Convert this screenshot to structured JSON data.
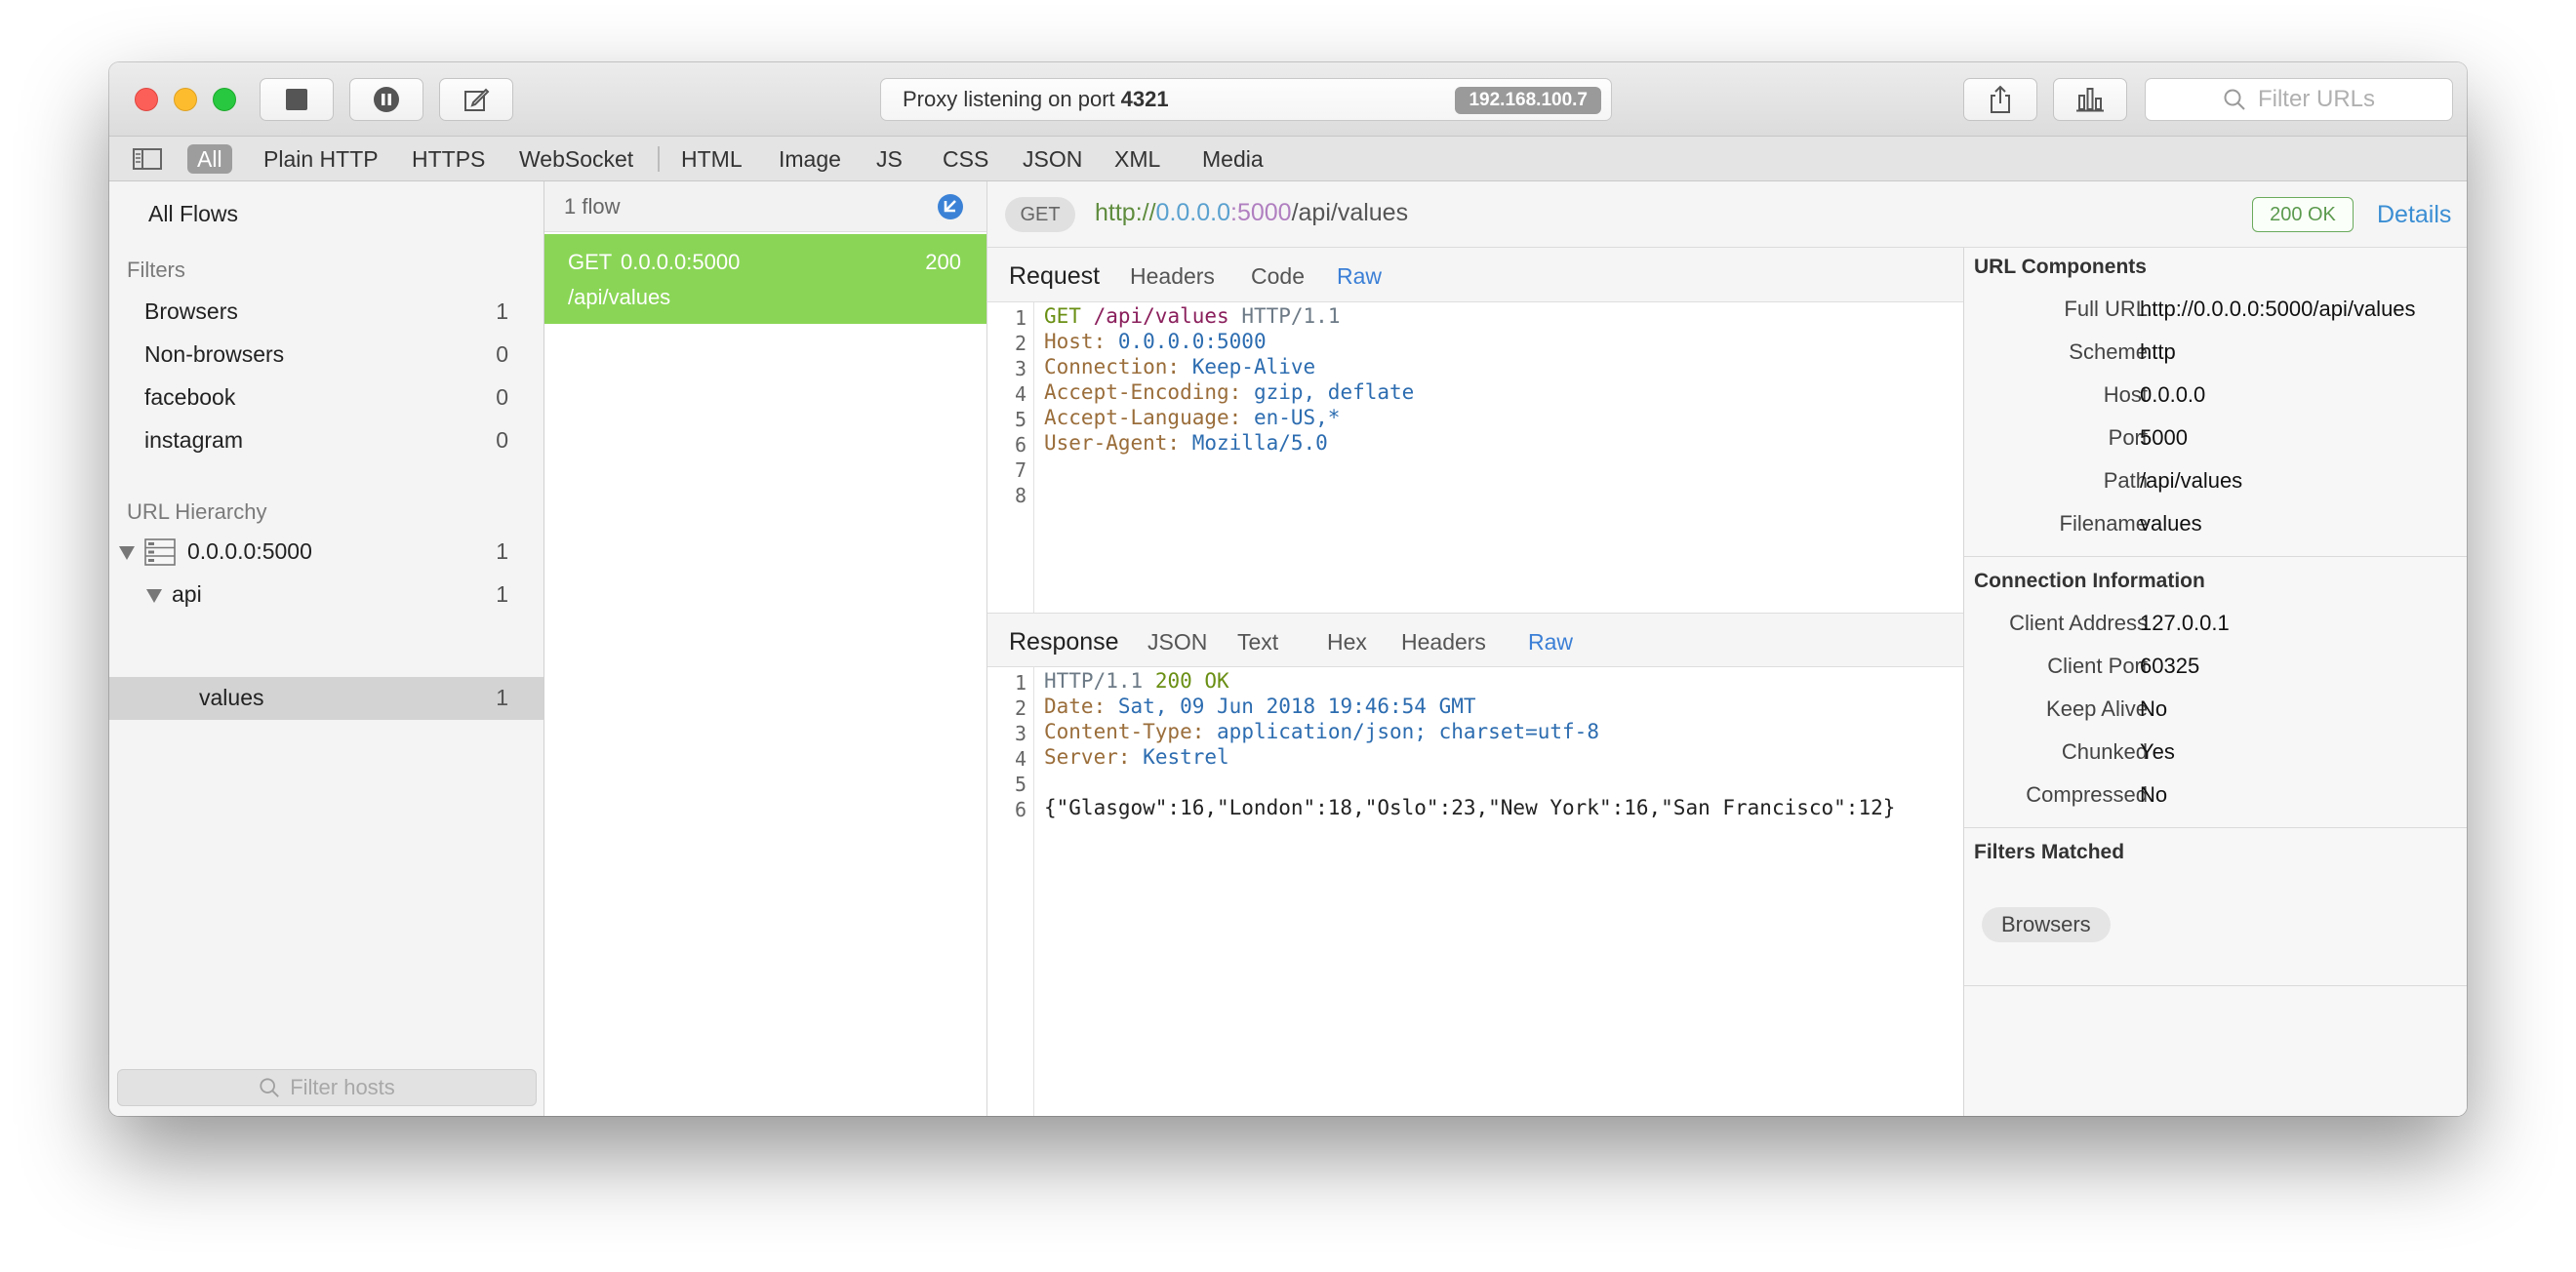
{
  "toolbar": {
    "status_text": "Proxy listening on port",
    "port": "4321",
    "ip": "192.168.100.7",
    "search_placeholder": "Filter URLs"
  },
  "filter_tabs": [
    "All",
    "Plain HTTP",
    "HTTPS",
    "WebSocket",
    "HTML",
    "Image",
    "JS",
    "CSS",
    "JSON",
    "XML",
    "Media"
  ],
  "sidebar": {
    "all_flows": "All Flows",
    "filters_heading": "Filters",
    "filters": [
      {
        "label": "Browsers",
        "count": "1"
      },
      {
        "label": "Non-browsers",
        "count": "0"
      },
      {
        "label": "facebook",
        "count": "0"
      },
      {
        "label": "instagram",
        "count": "0"
      }
    ],
    "hierarchy_heading": "URL Hierarchy",
    "hierarchy": [
      {
        "label": "0.0.0.0:5000",
        "count": "1"
      },
      {
        "label": "api",
        "count": "1"
      },
      {
        "label": "values",
        "count": "1"
      }
    ],
    "filter_hosts_placeholder": "Filter hosts"
  },
  "flows": {
    "count_label": "1 flow",
    "items": [
      {
        "method": "GET",
        "host": "0.0.0.0:5000",
        "status": "200",
        "path": "/api/values"
      }
    ]
  },
  "detail": {
    "method": "GET",
    "url": {
      "scheme": "http://",
      "host": "0.0.0.0",
      "port": ":5000",
      "path": "/api/values"
    },
    "status_badge": "200 OK",
    "details_link": "Details",
    "request": {
      "title": "Request",
      "tabs": [
        "Headers",
        "Code",
        "Raw"
      ],
      "line_numbers": [
        "1",
        "2",
        "3",
        "4",
        "5",
        "6",
        "7",
        "8"
      ],
      "request_line": {
        "method": "GET",
        "path": "/api/values",
        "version": "HTTP/1.1"
      },
      "headers": [
        {
          "key": "Host:",
          "value": "0.0.0.0:5000"
        },
        {
          "key": "Connection:",
          "value": "Keep-Alive"
        },
        {
          "key": "Accept-Encoding:",
          "value": "gzip, deflate"
        },
        {
          "key": "Accept-Language:",
          "value": "en-US,*"
        },
        {
          "key": "User-Agent:",
          "value": "Mozilla/5.0"
        }
      ]
    },
    "response": {
      "title": "Response",
      "tabs": [
        "JSON",
        "Text",
        "Hex",
        "Headers",
        "Raw"
      ],
      "line_numbers": [
        "1",
        "2",
        "3",
        "4",
        "5",
        "6"
      ],
      "status_line": {
        "version": "HTTP/1.1",
        "code": "200 OK"
      },
      "headers": [
        {
          "key": "Date:",
          "value": "Sat, 09 Jun 2018 19:46:54 GMT"
        },
        {
          "key": "Content-Type:",
          "value": "application/json; charset=utf-8"
        },
        {
          "key": "Server:",
          "value": "Kestrel"
        }
      ],
      "body": "{\"Glasgow\":16,\"London\":18,\"Oslo\":23,\"New York\":16,\"San Francisco\":12}"
    }
  },
  "info": {
    "url_components": {
      "heading": "URL Components",
      "rows": [
        {
          "label": "Full URL",
          "value": "http://0.0.0.0:5000/api/values"
        },
        {
          "label": "Scheme",
          "value": "http"
        },
        {
          "label": "Host",
          "value": "0.0.0.0"
        },
        {
          "label": "Port",
          "value": "5000"
        },
        {
          "label": "Path",
          "value": "/api/values"
        },
        {
          "label": "Filename",
          "value": "values"
        }
      ]
    },
    "connection": {
      "heading": "Connection Information",
      "rows": [
        {
          "label": "Client Address",
          "value": "127.0.0.1"
        },
        {
          "label": "Client Port",
          "value": "60325"
        },
        {
          "label": "Keep Alive",
          "value": "No"
        },
        {
          "label": "Chunked",
          "value": "Yes"
        },
        {
          "label": "Compressed",
          "value": "No"
        }
      ]
    },
    "filters_matched": {
      "heading": "Filters Matched",
      "chips": [
        "Browsers"
      ]
    }
  }
}
